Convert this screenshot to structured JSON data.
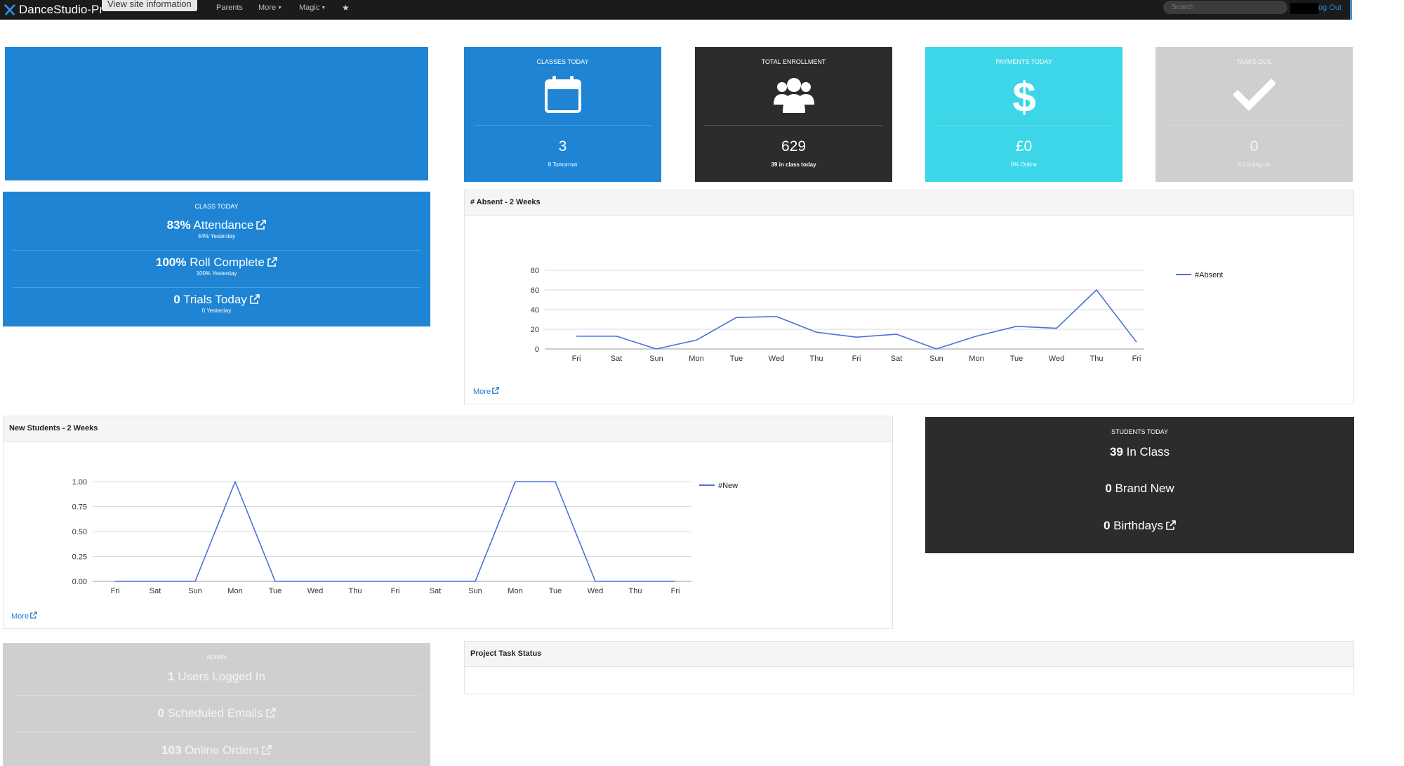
{
  "app": {
    "brand": "DanceStudio-Pr",
    "tooltip": "View site information",
    "nav": [
      {
        "label": "Parents",
        "caret": false
      },
      {
        "label": "More",
        "caret": true
      },
      {
        "label": "Magic",
        "caret": true
      }
    ],
    "search_placeholder": "Search",
    "logout": "og Out"
  },
  "stats": {
    "classes": {
      "title": "CLASSES TODAY",
      "value": "3",
      "sub": "8 Tomorrow",
      "icon": "calendar-icon"
    },
    "enrollment": {
      "title": "TOTAL ENROLLMENT",
      "value": "629",
      "sub": "39 in class today",
      "icon": "users-icon"
    },
    "payments": {
      "title": "PAYMENTS TODAY",
      "value": "£0",
      "sub": "0% Online",
      "icon": "dollar-icon"
    },
    "tasks": {
      "title": "TASKS DUE",
      "value": "0",
      "sub": "8 Coming Up",
      "icon": "check-icon"
    }
  },
  "class_today": {
    "title": "CLASS TODAY",
    "rows": [
      {
        "strong": "83%",
        "label": "Attendance",
        "sub": "44% Yesterday"
      },
      {
        "strong": "100%",
        "label": "Roll Complete",
        "sub": "100% Yesterday"
      },
      {
        "strong": "0",
        "label": "Trials Today",
        "sub": "0 Yesterday"
      }
    ]
  },
  "students_today": {
    "title": "STUDENTS TODAY",
    "rows": [
      {
        "strong": "39",
        "label": "In Class"
      },
      {
        "strong": "0",
        "label": "Brand New"
      },
      {
        "strong": "0",
        "label": "Birthdays"
      }
    ]
  },
  "admin": {
    "title": "ADMIN",
    "rows": [
      {
        "strong": "1",
        "label": "Users Logged In"
      },
      {
        "strong": "0",
        "label": "Scheduled Emails"
      },
      {
        "strong": "103",
        "label": "Online Orders"
      }
    ]
  },
  "panels": {
    "absent_title": "# Absent - 2 Weeks",
    "new_title": "New Students - 2 Weeks",
    "project_title": "Project Task Status",
    "more": "More"
  },
  "colors": {
    "line": "#4a72d6",
    "blue": "#1e84d3",
    "dark": "#2c2c2c",
    "cyan": "#3cd6e8",
    "grey": "#cfcfcf"
  },
  "chart_data": [
    {
      "type": "line",
      "title": "# Absent - 2 Weeks",
      "categories": [
        "Fri",
        "Sat",
        "Sun",
        "Mon",
        "Tue",
        "Wed",
        "Thu",
        "Fri",
        "Sat",
        "Sun",
        "Mon",
        "Tue",
        "Wed",
        "Thu",
        "Fri"
      ],
      "series": [
        {
          "name": "#Absent",
          "values": [
            13,
            13,
            0,
            9,
            32,
            33,
            17,
            12,
            15,
            0,
            13,
            23,
            21,
            60,
            7
          ]
        }
      ],
      "yticks": [
        "0",
        "20",
        "40",
        "60",
        "80"
      ],
      "ylim": [
        0,
        80
      ],
      "grid": true,
      "legend": "right"
    },
    {
      "type": "line",
      "title": "New Students - 2 Weeks",
      "categories": [
        "Fri",
        "Sat",
        "Sun",
        "Mon",
        "Tue",
        "Wed",
        "Thu",
        "Fri",
        "Sat",
        "Sun",
        "Mon",
        "Tue",
        "Wed",
        "Thu",
        "Fri"
      ],
      "series": [
        {
          "name": "#New",
          "values": [
            0,
            0,
            0,
            1,
            0,
            0,
            0,
            0,
            0,
            0,
            1,
            1,
            0,
            0,
            0
          ]
        }
      ],
      "yticks": [
        "0.00",
        "0.25",
        "0.50",
        "0.75",
        "1.00"
      ],
      "ylim": [
        0,
        1
      ],
      "grid": true,
      "legend": "right"
    }
  ]
}
